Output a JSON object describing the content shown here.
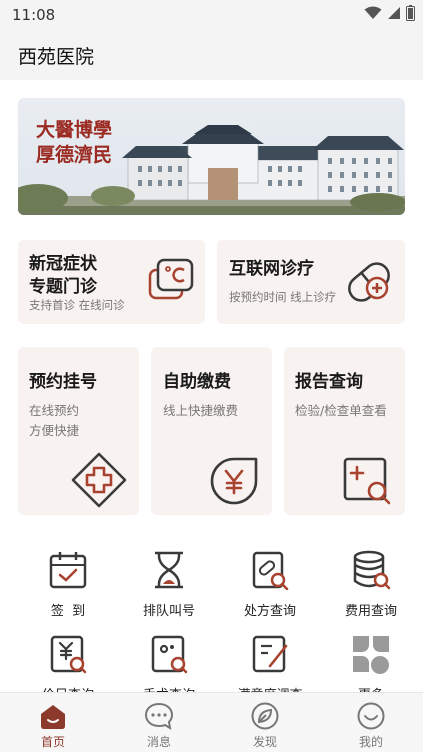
{
  "status_bar": {
    "time": "11:08"
  },
  "header": {
    "title": "西苑医院"
  },
  "banner": {
    "calligraphy_line1": "大醫博學",
    "calligraphy_line2": "厚德濟民"
  },
  "feature_cards": [
    {
      "title_line1": "新冠症状",
      "title_line2": "专题门诊",
      "subtitle": "支持首诊 在线问诊",
      "icon": "thermometer-chat-icon"
    },
    {
      "title_line1": "互联网诊疗",
      "subtitle": "按预约时间 线上诊疗",
      "icon": "pill-icon"
    }
  ],
  "service_cards": [
    {
      "title": "预约挂号",
      "subtitle_line1": "在线预约",
      "subtitle_line2": "方便快捷",
      "icon": "medical-cross-icon"
    },
    {
      "title": "自助缴费",
      "subtitle_line1": "线上快捷缴费",
      "icon": "yen-icon"
    },
    {
      "title": "报告查询",
      "subtitle_line1": "检验/检查单查看",
      "icon": "report-search-icon"
    }
  ],
  "grid": [
    {
      "label": "签  到",
      "icon": "calendar-check-icon"
    },
    {
      "label": "排队叫号",
      "icon": "hourglass-icon"
    },
    {
      "label": "处方查询",
      "icon": "prescription-search-icon"
    },
    {
      "label": "费用查询",
      "icon": "coins-search-icon"
    },
    {
      "label": "价目查询",
      "icon": "price-search-icon"
    },
    {
      "label": "手术查询",
      "icon": "surgery-search-icon"
    },
    {
      "label": "满意度调查",
      "icon": "survey-pen-icon"
    },
    {
      "label": "更多",
      "icon": "more-grid-icon"
    }
  ],
  "tabs": [
    {
      "label": "首页",
      "icon": "home-icon",
      "active": true
    },
    {
      "label": "消息",
      "icon": "message-icon",
      "active": false
    },
    {
      "label": "发现",
      "icon": "discover-leaf-icon",
      "active": false
    },
    {
      "label": "我的",
      "icon": "profile-icon",
      "active": false
    }
  ],
  "colors": {
    "accent": "#8c3a2c",
    "card_bg": "#f8f2f1",
    "icon_dark": "#3a3a3a",
    "icon_accent": "#a8432f"
  }
}
